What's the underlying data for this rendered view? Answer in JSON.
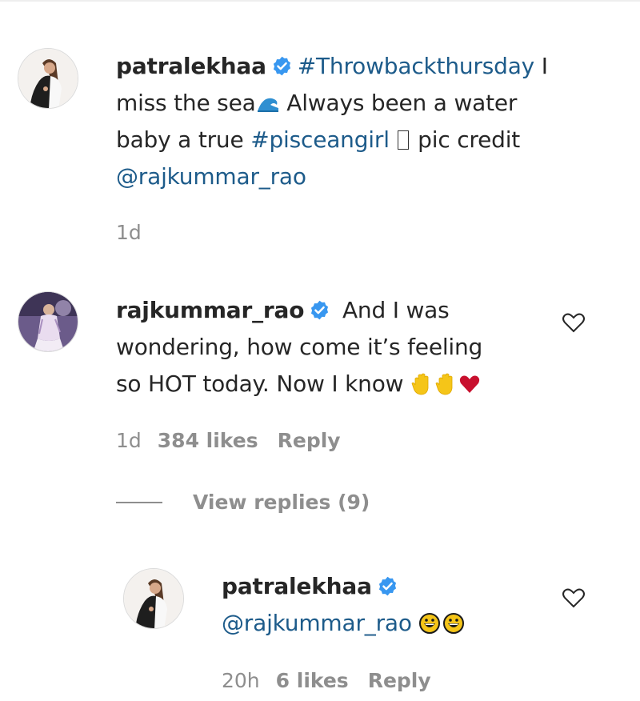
{
  "caption": {
    "username": "patralekhaa",
    "verified_icon": "verified-badge-icon",
    "hashtag_throwback": "#Throwbackthursday",
    "text_part1": " I",
    "text_part2": "miss the sea",
    "wave_icon": "water-wave-icon",
    "text_part3": " Always been a water",
    "text_part4": "baby a true ",
    "hashtag_pisces": "#pisceangirl",
    "missing_glyph": "▯",
    "text_part5": " pic credit",
    "mention": "@rajkummar_rao",
    "time": "1d"
  },
  "comment": {
    "username": "rajkummar_rao",
    "text_line1": " And I was",
    "text_line2": "wondering, how come it’s feeling",
    "text_line3": "so HOT today. Now I know ",
    "emojis": [
      "raised-hand-icon",
      "raised-hand-icon",
      "red-heart-icon"
    ],
    "time": "1d",
    "likes": "384 likes",
    "reply_label": "Reply",
    "view_replies": "View replies (9)"
  },
  "reply": {
    "username": "patralekhaa",
    "mention": "@rajkummar_rao",
    "emojis": [
      "grinning-face-icon",
      "grinning-face-icon"
    ],
    "time": "20h",
    "likes": "6 likes",
    "reply_label": "Reply"
  },
  "colors": {
    "text": "#262626",
    "link": "#1d5b8a",
    "meta": "#8e8e8e",
    "verified": "#3897f0",
    "heart": "#ed4956",
    "hand": "#f5c518"
  }
}
